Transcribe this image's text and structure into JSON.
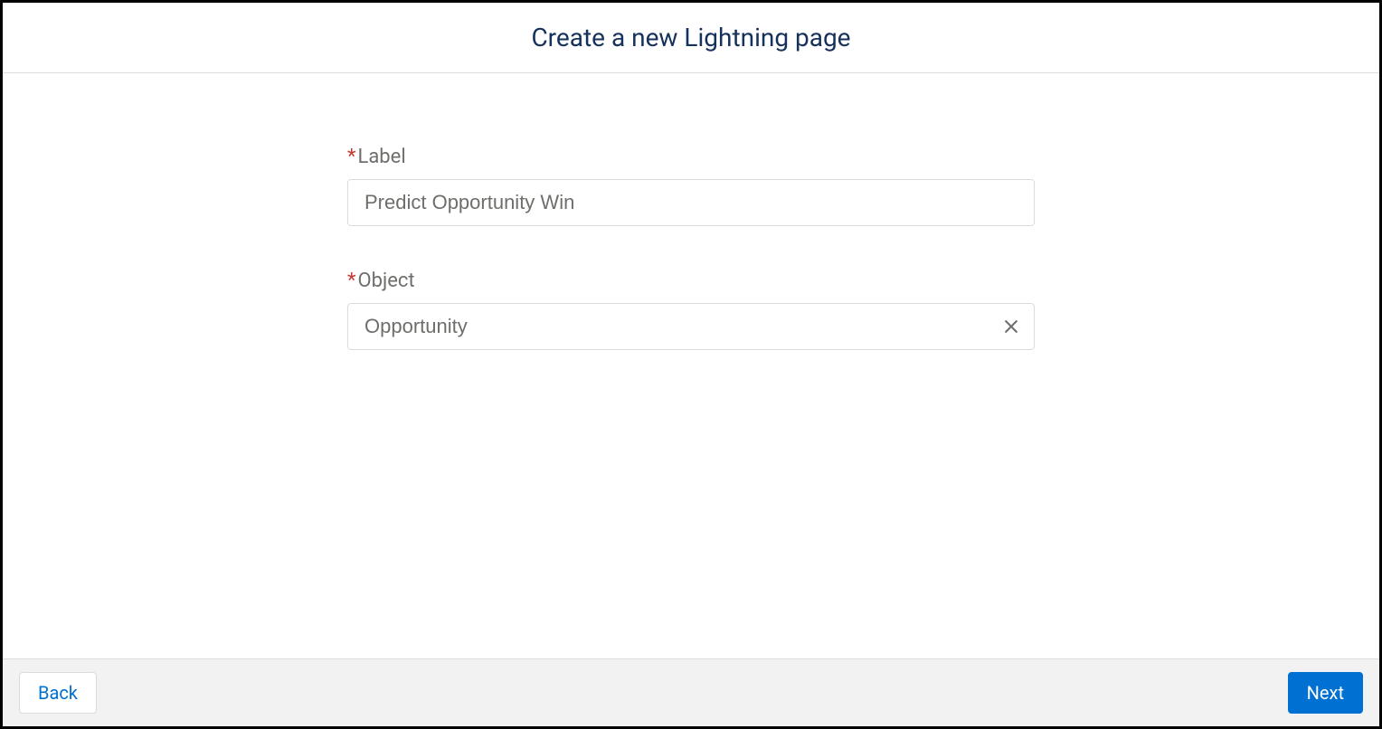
{
  "header": {
    "title": "Create a new Lightning page"
  },
  "form": {
    "required_indicator": "*",
    "label_field": {
      "label": "Label",
      "value": "Predict Opportunity Win"
    },
    "object_field": {
      "label": "Object",
      "value": "Opportunity"
    }
  },
  "footer": {
    "back_label": "Back",
    "next_label": "Next"
  }
}
